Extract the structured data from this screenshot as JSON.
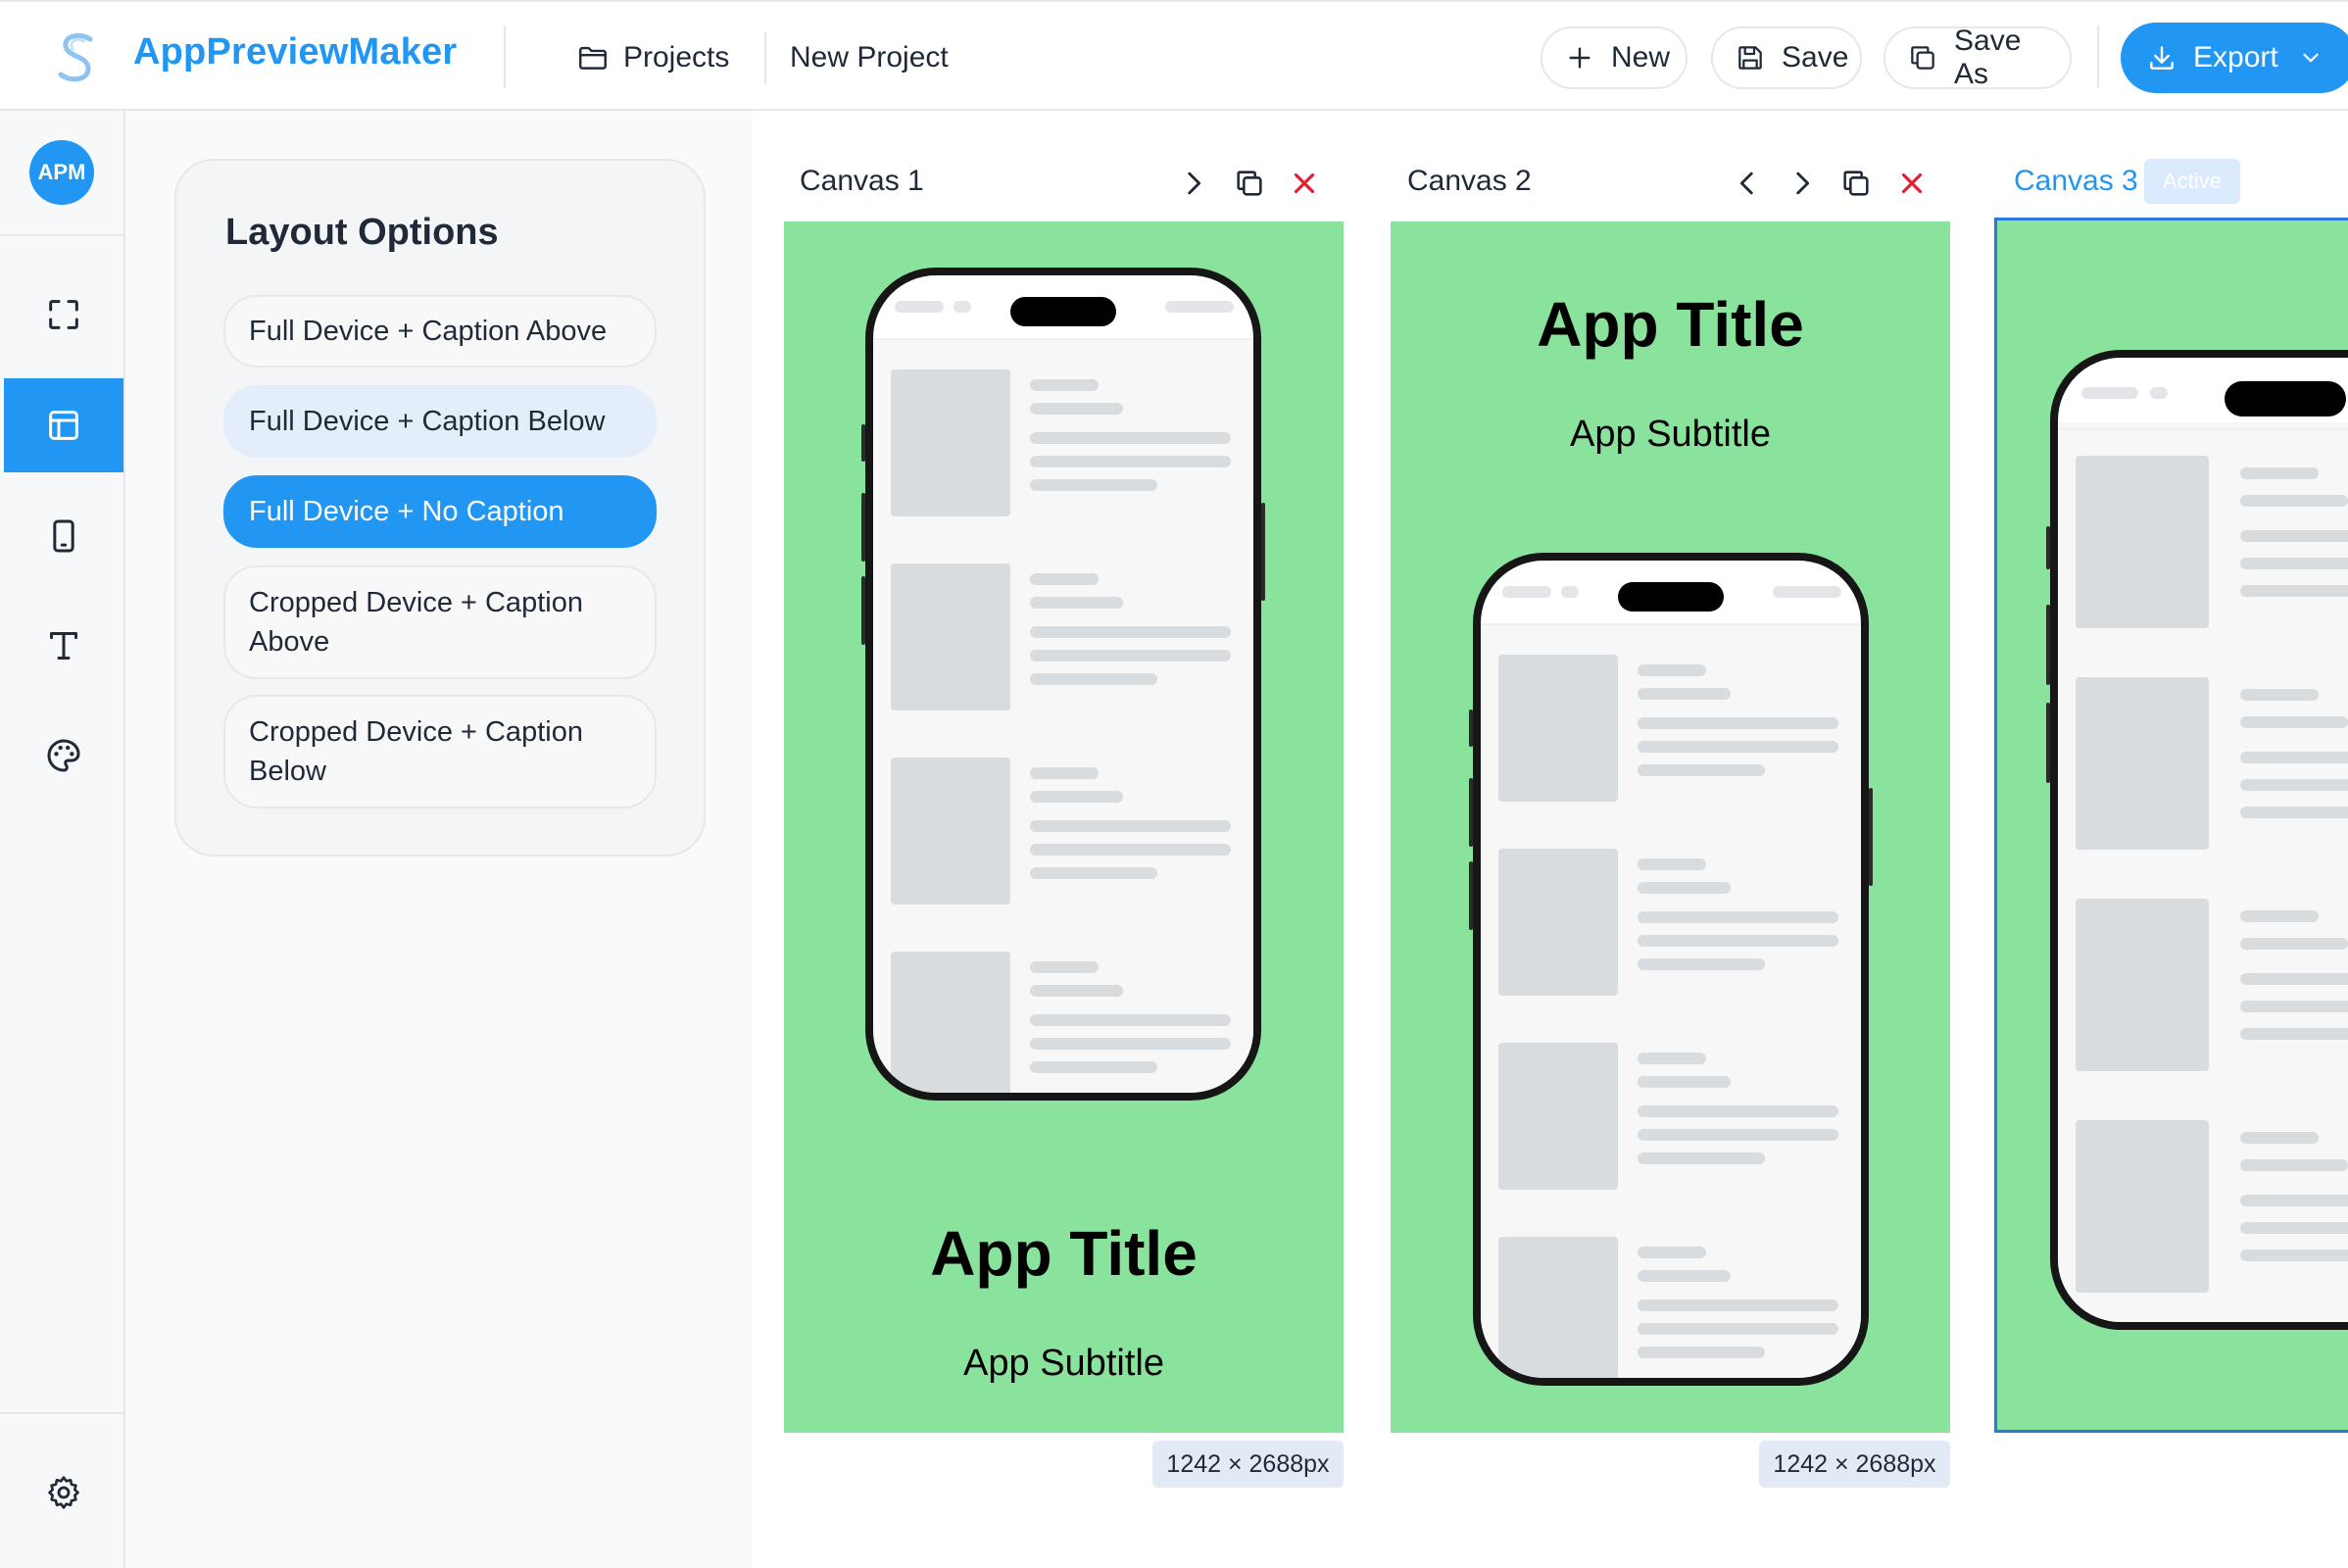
{
  "app": {
    "brand": "AppPreviewMaker",
    "avatar_initials": "APM"
  },
  "header": {
    "nav": [
      {
        "label": "Projects",
        "icon": "folder-icon"
      },
      {
        "label": "New Project"
      }
    ],
    "buttons": [
      {
        "label": "New",
        "icon": "plus-icon"
      },
      {
        "label": "Save",
        "icon": "floppy-icon"
      },
      {
        "label": "Save As",
        "icon": "copy-icon"
      }
    ],
    "export": {
      "label": "Export",
      "icon": "download-icon"
    }
  },
  "sidebar": {
    "items": [
      {
        "icon": "fullscreen-icon",
        "active": false
      },
      {
        "icon": "layout-icon",
        "active": true
      },
      {
        "icon": "device-icon",
        "active": false
      },
      {
        "icon": "text-icon",
        "active": false
      },
      {
        "icon": "palette-icon",
        "active": false
      }
    ],
    "footer_icon": "gear-icon"
  },
  "layout_options": {
    "title": "Layout Options",
    "options": [
      {
        "label": "Full Device + Caption Above",
        "state": "default"
      },
      {
        "label": "Full Device + Caption Below",
        "state": "hover"
      },
      {
        "label": "Full Device + No Caption",
        "state": "selected"
      },
      {
        "label": "Cropped Device + Caption Above",
        "state": "default"
      },
      {
        "label": "Cropped Device + Caption Below",
        "state": "default"
      }
    ]
  },
  "canvases": [
    {
      "label": "Canvas 1",
      "title": "App Title",
      "subtitle": "App Subtitle",
      "size": "1242 × 2688px",
      "background": "#8ae39c"
    },
    {
      "label": "Canvas 2",
      "title": "App Title",
      "subtitle": "App Subtitle",
      "size": "1242 × 2688px",
      "background": "#8ae39c"
    },
    {
      "label": "Canvas 3",
      "badge": "Active",
      "background": "#8ae39c"
    }
  ],
  "colors": {
    "accent": "#2196f3",
    "danger": "#e11d2e",
    "canvas_bg": "#8ae39c"
  }
}
